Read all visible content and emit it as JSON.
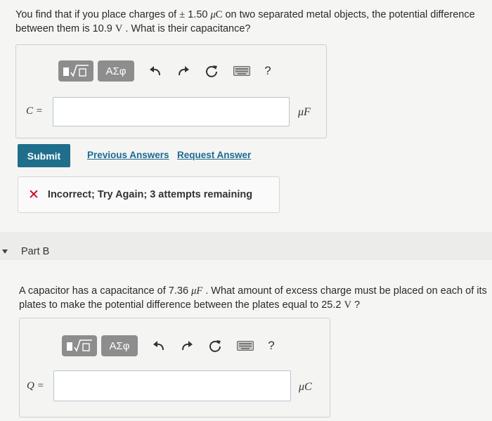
{
  "partA": {
    "question": {
      "t1": "You find that if you place charges of ",
      "pm": "±",
      "t2": " 1.50 ",
      "mu": "μ",
      "c": "C",
      "t3": " on two separated metal objects, the potential difference between them is 10.9 ",
      "v": "V",
      "t4": " . What is their capacitance?"
    },
    "toolbar": {
      "symbols_label": "ΑΣφ",
      "help_label": "?"
    },
    "variable_label": "C =",
    "input_value": "",
    "unit": "μF",
    "submit_label": "Submit",
    "previous_answers_label": "Previous Answers",
    "request_answer_label": "Request Answer",
    "feedback": {
      "icon": "✕",
      "text": "Incorrect; Try Again; 3 attempts remaining"
    }
  },
  "partB": {
    "label": "Part B",
    "question": {
      "t1": "A capacitor has a capacitance of 7.36 ",
      "unit_f": "μF",
      "t2": " . What amount of excess charge must be placed on each of its plates to make the potential difference between the plates equal to 25.2 ",
      "v": "V",
      "t3": " ?"
    },
    "toolbar": {
      "symbols_label": "ΑΣφ",
      "help_label": "?"
    },
    "variable_label": "Q =",
    "input_value": "",
    "unit": "μC"
  },
  "colors": {
    "submit_bg": "#1f6e8c",
    "link": "#1b6a90",
    "error_x": "#d0021b",
    "toolbar_gray": "#8d8d8d"
  }
}
